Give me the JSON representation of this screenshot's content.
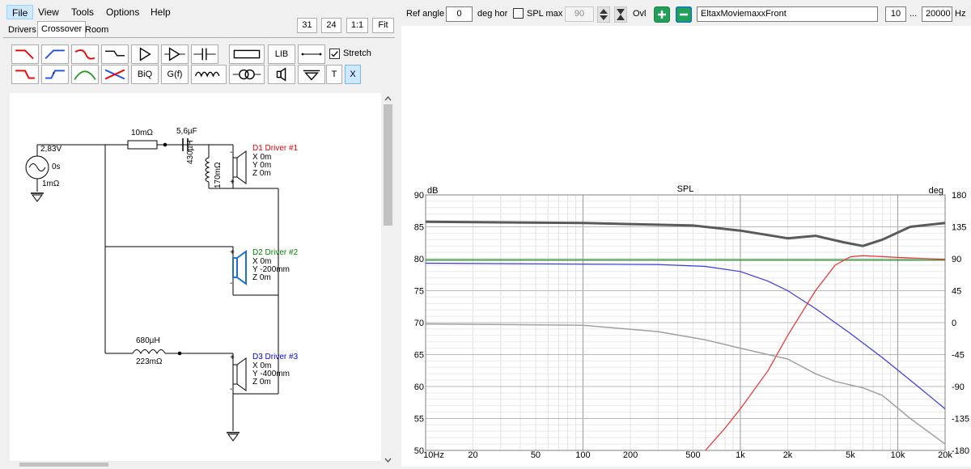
{
  "menu": {
    "file": "File",
    "view": "View",
    "tools": "Tools",
    "options": "Options",
    "help": "Help"
  },
  "zoom": {
    "z31": "31",
    "z24": "24",
    "one": "1:1",
    "fit": "Fit"
  },
  "tabs": {
    "drivers": "Drivers",
    "crossover": "Crossover",
    "room": "Room"
  },
  "toolbar": {
    "lib": "LIB",
    "stretch": "Stretch",
    "biq": "BiQ",
    "gf": "G(f)",
    "t": "T",
    "x": "X"
  },
  "schematic": {
    "source": {
      "voltage": "2,83V",
      "delay": "0s",
      "resistance": "1mΩ"
    },
    "r1": "10mΩ",
    "c1": "5,6µF",
    "l1": "430µH",
    "l1r": "170mΩ",
    "l2": "680µH",
    "l2r": "223mΩ",
    "d1": {
      "name": "D1 Driver #1",
      "x": "X 0m",
      "y": "Y 0m",
      "z": "Z 0m",
      "color": "#e00000"
    },
    "d2": {
      "name": "D2 Driver #2",
      "x": "X 0m",
      "y": "Y -200mm",
      "z": "Z 0m",
      "color": "#008000"
    },
    "d3": {
      "name": "D3 Driver #3",
      "x": "X 0m",
      "y": "Y -400mm",
      "z": "Z 0m",
      "color": "#0000e0"
    }
  },
  "controls": {
    "ref_angle_label": "Ref angle",
    "ref_angle_value": "0",
    "deg_hor": "deg hor",
    "spl_max_label": "SPL max",
    "spl_max_value": "90",
    "ovl": "Ovl",
    "name_value": "EltaxMoviemaxxFront",
    "f_min": "10",
    "dots": "...",
    "f_max": "20000",
    "hz": "Hz"
  },
  "chart_data": {
    "type": "line",
    "title": "SPL",
    "ylabel": "dB",
    "y2label": "deg",
    "x_scale": "log",
    "xlim": [
      10,
      20000
    ],
    "ylim": [
      50,
      90
    ],
    "y2lim": [
      -180,
      180
    ],
    "grid": true,
    "xtick_labels": [
      {
        "v": 10,
        "t": "10Hz"
      },
      {
        "v": 20,
        "t": "20"
      },
      {
        "v": 50,
        "t": "50"
      },
      {
        "v": 100,
        "t": "100"
      },
      {
        "v": 200,
        "t": "200"
      },
      {
        "v": 500,
        "t": "500"
      },
      {
        "v": 1000,
        "t": "1k"
      },
      {
        "v": 2000,
        "t": "2k"
      },
      {
        "v": 5000,
        "t": "5k"
      },
      {
        "v": 10000,
        "t": "10k"
      },
      {
        "v": 20000,
        "t": "20k"
      }
    ],
    "ytick_labels": [
      "50",
      "55",
      "60",
      "65",
      "70",
      "75",
      "80",
      "85",
      "90"
    ],
    "y2tick_labels": [
      "-180",
      "-135",
      "-90",
      "-45",
      "0",
      "45",
      "90",
      "135",
      "180"
    ],
    "series": [
      {
        "color": "#5a5a5a",
        "width": 3,
        "points": [
          [
            10,
            85.8
          ],
          [
            100,
            85.6
          ],
          [
            500,
            85.2
          ],
          [
            1000,
            84.4
          ],
          [
            2000,
            83.2
          ],
          [
            3000,
            83.6
          ],
          [
            4500,
            82.6
          ],
          [
            6000,
            82.0
          ],
          [
            8000,
            83.0
          ],
          [
            12000,
            85.0
          ],
          [
            20000,
            85.6
          ]
        ]
      },
      {
        "color": "#2f9a2f",
        "width": 1.5,
        "points": [
          [
            10,
            79.8
          ],
          [
            1000,
            79.8
          ],
          [
            20000,
            79.8
          ]
        ]
      },
      {
        "color": "#3a3ae0",
        "width": 1.2,
        "points": [
          [
            10,
            79.3
          ],
          [
            300,
            79.1
          ],
          [
            600,
            78.8
          ],
          [
            1000,
            78.0
          ],
          [
            1500,
            76.5
          ],
          [
            2000,
            75.0
          ],
          [
            3000,
            72.2
          ],
          [
            5000,
            68.3
          ],
          [
            8000,
            64.5
          ],
          [
            12000,
            61.0
          ],
          [
            20000,
            56.5
          ]
        ]
      },
      {
        "color": "#e83030",
        "width": 1.2,
        "points": [
          [
            600,
            50
          ],
          [
            800,
            53.5
          ],
          [
            1000,
            56.5
          ],
          [
            1500,
            62.5
          ],
          [
            2000,
            68.0
          ],
          [
            3000,
            75.0
          ],
          [
            4000,
            79.0
          ],
          [
            5000,
            80.3
          ],
          [
            6000,
            80.5
          ],
          [
            10000,
            80.2
          ],
          [
            20000,
            79.9
          ]
        ]
      },
      {
        "color": "#a0a0a0",
        "width": 1.5,
        "points": [
          [
            10,
            69.8
          ],
          [
            100,
            69.6
          ],
          [
            300,
            68.6
          ],
          [
            600,
            67.3
          ],
          [
            1000,
            66.0
          ],
          [
            1500,
            65.0
          ],
          [
            2000,
            64.3
          ],
          [
            3000,
            62.0
          ],
          [
            4000,
            60.8
          ],
          [
            6000,
            59.8
          ],
          [
            8000,
            58.6
          ],
          [
            12000,
            55.0
          ],
          [
            20000,
            51.0
          ]
        ]
      }
    ]
  }
}
